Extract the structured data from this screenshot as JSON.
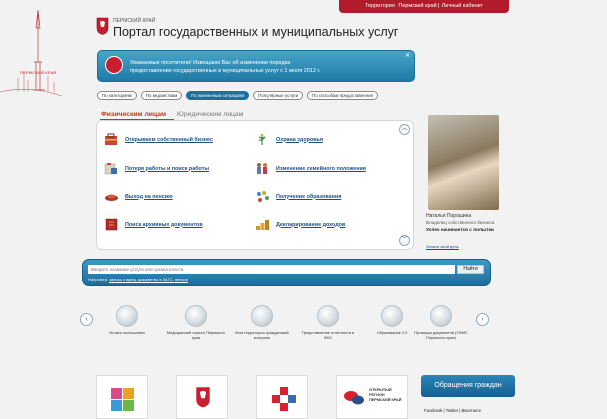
{
  "topbar": {
    "territory_label": "Территория",
    "region_name": "Пермский край",
    "cabinet_link": "Личный кабинет"
  },
  "header": {
    "region_label": "ПЕРМСКИЙ КРАЙ",
    "portal_title": "Портал государственных и муниципальных услуг",
    "side_caption": "ПЕРМСКИЙ КРАЙ"
  },
  "notice": {
    "line1": "Уважаемые посетители! Извещаем Вас об изменении порядка",
    "line2": "предоставления государственных и муниципальных услуг с 1 июля 2012 г."
  },
  "filters": [
    {
      "label": "По категориям",
      "active": false
    },
    {
      "label": "По ведомствам",
      "active": false
    },
    {
      "label": "По жизненным ситуациям",
      "active": true
    },
    {
      "label": "Популярные услуги",
      "active": false
    },
    {
      "label": "По способам предоставления",
      "active": false
    }
  ],
  "tabs": {
    "individuals": "Физическим лицам",
    "legal": "Юридическим лицам"
  },
  "services": [
    {
      "label": "Открываем собственный бизнес",
      "icon": "business-icon"
    },
    {
      "label": "Охрана здоровья",
      "icon": "health-icon"
    },
    {
      "label": "Потеря работы и поиск работы",
      "icon": "job-search-icon"
    },
    {
      "label": "Изменение семейного положения",
      "icon": "family-icon"
    },
    {
      "label": "Выход на пенсию",
      "icon": "pension-icon"
    },
    {
      "label": "Получение образования",
      "icon": "education-icon"
    },
    {
      "label": "Поиск архивных документов",
      "icon": "archive-icon"
    },
    {
      "label": "Декларирование доходов",
      "icon": "income-declaration-icon"
    }
  ],
  "profile": {
    "name": "Наталья Порошина",
    "role": "Владелец собственного бизнеса",
    "success": "Успех начинается с попытки",
    "story_link": "Записи свой день"
  },
  "search": {
    "placeholder": "Введите название услуги или органа власти",
    "button": "Найти",
    "example_prefix": "Например:",
    "examples": "запись к врачу, документы в ЗАГС, пенсия"
  },
  "quick_services": [
    {
      "label": "Уплата госпошлины",
      "icon": "payment-icon"
    },
    {
      "label": "Медицинский портал Пермского края",
      "icon": "medical-portal-icon"
    },
    {
      "label": "Моя территория гражданский контроль",
      "icon": "civic-control-icon"
    },
    {
      "label": "Представление отчетности в ФНС",
      "icon": "tax-report-icon"
    },
    {
      "label": "Образование 2.0",
      "icon": "education-portal-icon"
    },
    {
      "label": "Проверка документов (УФМС Пермского края)",
      "icon": "document-check-icon"
    }
  ],
  "footer": {
    "open_region_text": "ОТКРЫТЫЙ РЕГИОН ПЕРМСКИЙ КРАЙ",
    "appeals_button": "Обращения граждан",
    "social_links": "Facebook  |  Twitter  |  Вконтакте"
  },
  "colors": {
    "brand_red": "#b31b2c",
    "brand_blue": "#1d6f9e",
    "link_blue": "#1f4e8a",
    "tab_active": "#c13a18"
  }
}
